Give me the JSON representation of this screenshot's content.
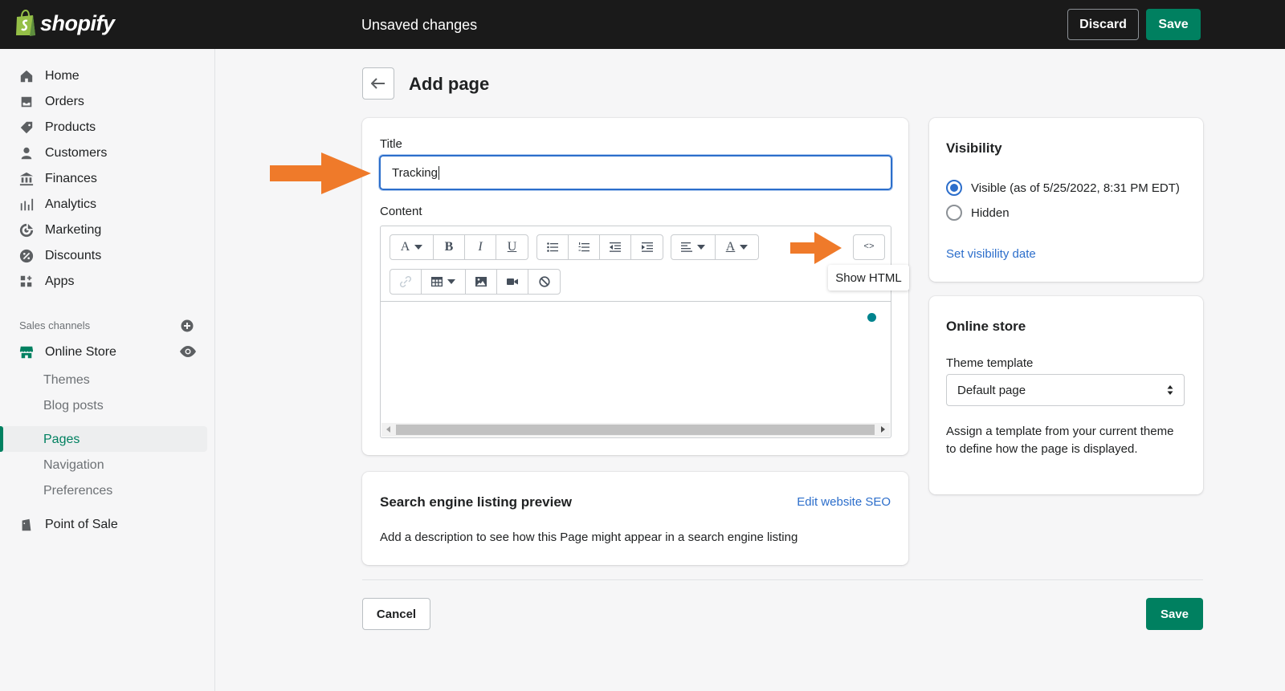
{
  "topbar": {
    "logo_text": "shopify",
    "status": "Unsaved changes",
    "discard_label": "Discard",
    "save_label": "Save"
  },
  "sidebar": {
    "items": [
      {
        "label": "Home",
        "icon": "home-icon"
      },
      {
        "label": "Orders",
        "icon": "orders-icon"
      },
      {
        "label": "Products",
        "icon": "tag-icon"
      },
      {
        "label": "Customers",
        "icon": "person-icon"
      },
      {
        "label": "Finances",
        "icon": "bank-icon"
      },
      {
        "label": "Analytics",
        "icon": "bar-chart-icon"
      },
      {
        "label": "Marketing",
        "icon": "target-icon"
      },
      {
        "label": "Discounts",
        "icon": "discount-icon"
      },
      {
        "label": "Apps",
        "icon": "apps-icon"
      }
    ],
    "sales_channels_label": "Sales channels",
    "online_store": {
      "label": "Online Store",
      "sub_items": [
        "Themes",
        "Blog posts",
        "Pages",
        "Navigation",
        "Preferences"
      ],
      "active": "Pages"
    },
    "point_of_sale": "Point of Sale"
  },
  "page": {
    "title": "Add page",
    "title_label": "Title",
    "title_value": "Tracking",
    "content_label": "Content",
    "show_html_tooltip": "Show HTML",
    "html_button_label": "<>"
  },
  "toolbar": {
    "format_label": "A",
    "bold_label": "B",
    "italic_label": "I",
    "underline_label": "U",
    "text_color_label": "A"
  },
  "seo": {
    "title": "Search engine listing preview",
    "edit_link": "Edit website SEO",
    "description": "Add a description to see how this Page might appear in a search engine listing"
  },
  "visibility": {
    "title": "Visibility",
    "options": [
      {
        "label": "Visible (as of 5/25/2022, 8:31 PM EDT)",
        "checked": true
      },
      {
        "label": "Hidden",
        "checked": false
      }
    ],
    "set_date_link": "Set visibility date"
  },
  "online_store_card": {
    "title": "Online store",
    "template_label": "Theme template",
    "template_value": "Default page",
    "description": "Assign a template from your current theme to define how the page is displayed."
  },
  "footer": {
    "cancel_label": "Cancel",
    "save_label": "Save"
  },
  "colors": {
    "brand_green": "#008060",
    "topbar": "#1a1a1a",
    "link_blue": "#2c6ecb",
    "annotation_orange": "#ef7a2a"
  }
}
